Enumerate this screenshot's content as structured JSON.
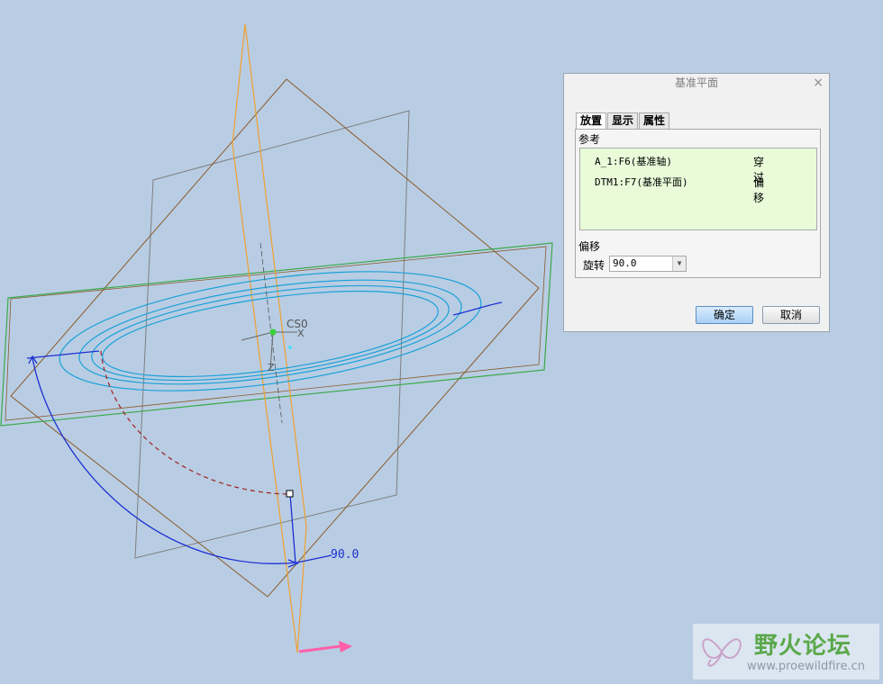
{
  "dialog": {
    "title": "基准平面",
    "close_glyph": "×",
    "tabs": [
      "放置",
      "显示",
      "属性"
    ],
    "active_tab": "放置",
    "references_label": "参考",
    "references": [
      {
        "name": "A_1:F6(基准轴)",
        "type": "穿过"
      },
      {
        "name": "DTM1:F7(基准平面)",
        "type": "偏移"
      }
    ],
    "offset_label": "偏移",
    "rotation_label": "旋转",
    "rotation_value": "90.0",
    "ok_label": "确定",
    "cancel_label": "取消"
  },
  "viewport": {
    "background": "#b8cde3",
    "csys_label": "CS0",
    "x_label": "X",
    "z_label": "Z",
    "angle_label": "90.0",
    "colors": {
      "brown_plane": "#8b5a2b",
      "orange_plane": "#f0a030",
      "green_plane": "#3aa84a",
      "gray_plane": "#7f7f7f",
      "cyan_curves": "#1aa0d8",
      "blue_drag": "#1c2fd4",
      "red_dash": "#a02020",
      "pink_arrow": "#ff5fa8"
    }
  },
  "watermark": {
    "name": "野火论坛",
    "url": "www.proewildfire.cn"
  }
}
